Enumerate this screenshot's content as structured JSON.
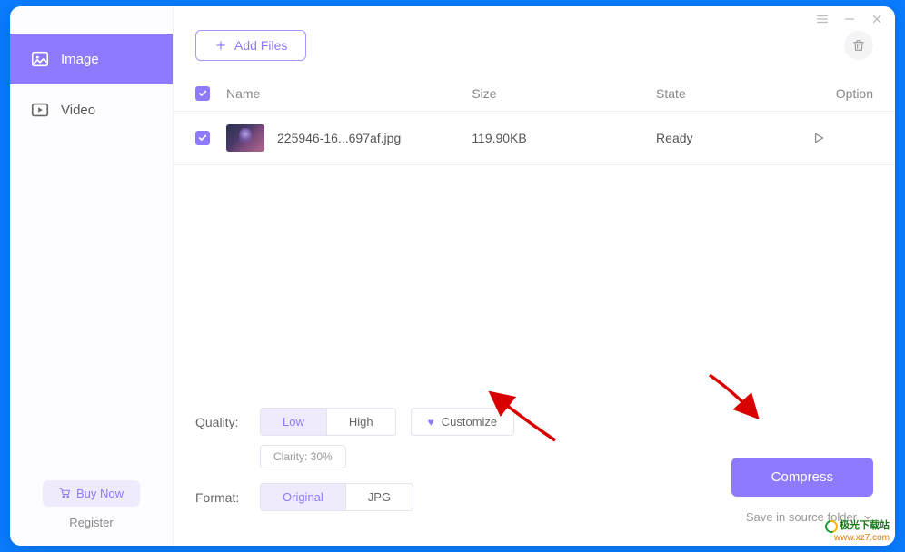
{
  "sidebar": {
    "image": "Image",
    "video": "Video",
    "buy_now": "Buy Now",
    "register": "Register"
  },
  "toolbar": {
    "add_files": "Add Files"
  },
  "table": {
    "headers": {
      "name": "Name",
      "size": "Size",
      "state": "State",
      "option": "Option"
    },
    "rows": [
      {
        "name": "225946-16...697af.jpg",
        "size": "119.90KB",
        "state": "Ready"
      }
    ]
  },
  "controls": {
    "quality_label": "Quality:",
    "low": "Low",
    "high": "High",
    "customize": "Customize",
    "clarity": "Clarity: 30%",
    "format_label": "Format:",
    "original": "Original",
    "jpg": "JPG",
    "compress": "Compress",
    "save_folder": "Save in source folder"
  },
  "watermark": {
    "line1": "极光下载站",
    "line2": "www.xz7.com"
  }
}
